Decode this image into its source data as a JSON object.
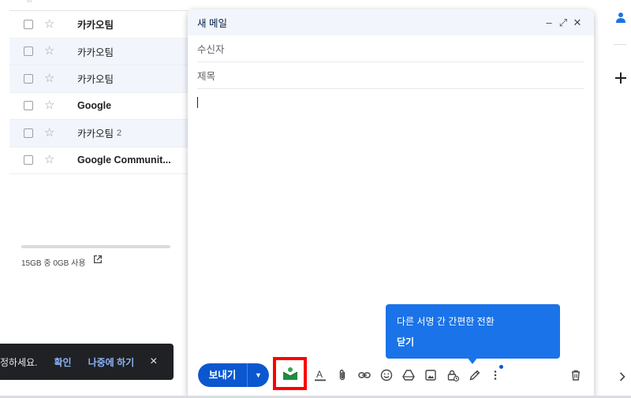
{
  "inbox": {
    "header_fragments": [
      "☆",
      "ㅅㅅ ㅍ"
    ],
    "rows": [
      {
        "sender": "카카오팀",
        "count": "",
        "read": false
      },
      {
        "sender": "카카오팀",
        "count": "",
        "read": true
      },
      {
        "sender": "카카오팀",
        "count": "",
        "read": true
      },
      {
        "sender": "Google",
        "count": "",
        "read": false
      },
      {
        "sender": "카카오팀",
        "count": "2",
        "read": true
      },
      {
        "sender": "Google Communit...",
        "count": "",
        "read": false
      }
    ],
    "storage_text": "15GB 중 0GB 사용",
    "storage_fraction": 0.0
  },
  "snackbar": {
    "message": "정하세요.",
    "confirm_label": "확인",
    "later_label": "나중에 하기",
    "close_icon": "×"
  },
  "compose": {
    "title": "새 메일",
    "minimize_icon": "–",
    "fullscreen_icon": "⤢",
    "close_icon": "✕",
    "to_placeholder": "수신자",
    "subject_placeholder": "제목",
    "send_label": "보내기",
    "send_options_icon": "▼"
  },
  "tooltip": {
    "text": "다른 서명 간 간편한 전환",
    "close_label": "닫기"
  },
  "colors": {
    "accent": "#0b57d0",
    "tooltip_bg": "#1a73e8",
    "highlight": "#ff0000",
    "snackbar_bg": "#202124",
    "snackbar_link": "#8ab4f8"
  },
  "icons": {
    "toolbar": [
      "formatting-icon",
      "attach-icon",
      "link-icon",
      "emoji-icon",
      "drive-icon",
      "photo-icon",
      "confidential-icon",
      "signature-icon",
      "more-options-icon",
      "discard-icon"
    ],
    "rail": [
      "contacts-icon",
      "add-icon",
      "expand-icon"
    ]
  }
}
